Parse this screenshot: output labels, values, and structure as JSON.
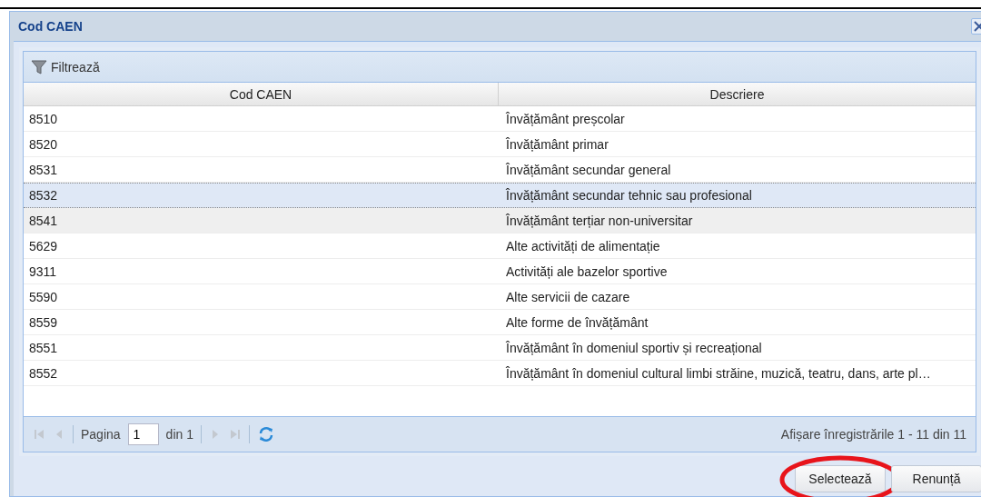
{
  "window": {
    "title": "Cod CAEN"
  },
  "toolbar": {
    "filter_label": "Filtrează"
  },
  "table": {
    "columns": [
      "Cod CAEN",
      "Descriere"
    ],
    "rows": [
      {
        "code": "8510",
        "description": "Învățământ preșcolar",
        "selected": false,
        "hovered": false
      },
      {
        "code": "8520",
        "description": "Învățământ primar",
        "selected": false,
        "hovered": false
      },
      {
        "code": "8531",
        "description": "Învățământ secundar general",
        "selected": false,
        "hovered": false
      },
      {
        "code": "8532",
        "description": "Învățământ secundar tehnic sau profesional",
        "selected": true,
        "hovered": false
      },
      {
        "code": "8541",
        "description": "Învățământ terțiar non-universitar",
        "selected": false,
        "hovered": true
      },
      {
        "code": "5629",
        "description": "Alte activități de alimentație",
        "selected": false,
        "hovered": false
      },
      {
        "code": "9311",
        "description": "Activități ale bazelor sportive",
        "selected": false,
        "hovered": false
      },
      {
        "code": "5590",
        "description": "Alte servicii de cazare",
        "selected": false,
        "hovered": false
      },
      {
        "code": "8559",
        "description": "Alte forme de învățământ",
        "selected": false,
        "hovered": false
      },
      {
        "code": "8551",
        "description": "Învățământ în domeniul sportiv și recreațional",
        "selected": false,
        "hovered": false
      },
      {
        "code": "8552",
        "description": "Învățământ în domeniul cultural limbi străine, muzică, teatru, dans, arte pl…",
        "selected": false,
        "hovered": false
      }
    ]
  },
  "paging": {
    "page_label": "Pagina",
    "page_value": "1",
    "of_label": "din 1",
    "summary": "Afișare înregistrările 1 - 11 din 11"
  },
  "buttons": [
    {
      "label": "Selectează",
      "circled": true
    },
    {
      "label": "Renunță",
      "circled": false
    }
  ]
}
